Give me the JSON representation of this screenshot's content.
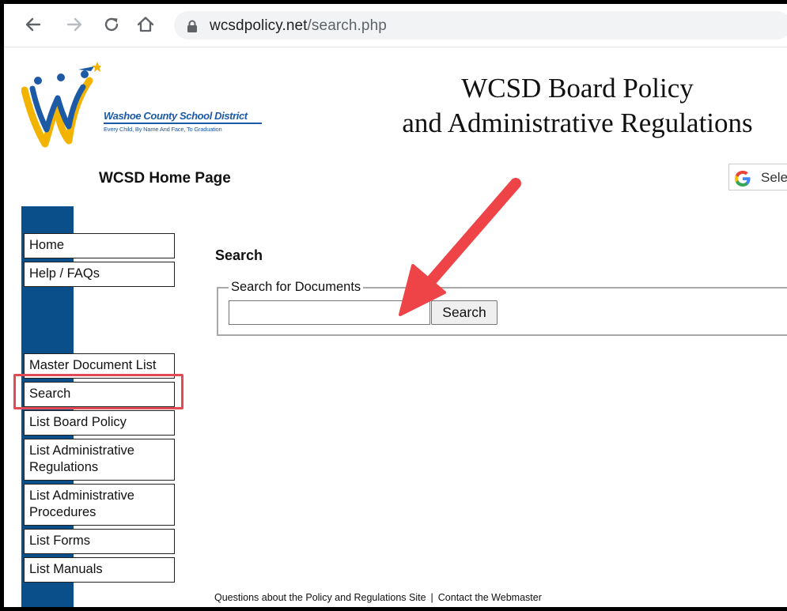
{
  "browser": {
    "url_domain": "wcsdpolicy.net",
    "url_path": "/search.php"
  },
  "header": {
    "logo_name": "Washoe County School District",
    "logo_tagline": "Every Child, By Name And Face, To Graduation",
    "title_line1": "WCSD Board Policy",
    "title_line2": "and Administrative Regulations",
    "home_link": "WCSD Home Page",
    "translate_label": "Sele"
  },
  "sidebar": {
    "items": [
      {
        "label": "Home"
      },
      {
        "label": "Help / FAQs"
      },
      {
        "label": "Master Document List"
      },
      {
        "label": "Search"
      },
      {
        "label": "List Board Policy"
      },
      {
        "label": "List Administrative Regulations"
      },
      {
        "label": "List Administrative Procedures"
      },
      {
        "label": "List Forms"
      },
      {
        "label": "List Manuals"
      }
    ]
  },
  "main": {
    "heading": "Search",
    "legend": "Search for Documents",
    "search_value": "",
    "search_button": "Search"
  },
  "footer": {
    "link1": "Questions about the Policy and Regulations Site",
    "separator": "|",
    "link2": "Contact the Webmaster"
  },
  "colors": {
    "sidebar": "#0b4f8a",
    "highlight": "#e24a55",
    "arrow": "#ee4448",
    "logo_blue": "#1c5aa6",
    "logo_gold": "#f2b400"
  },
  "icons": [
    "back-arrow-icon",
    "forward-arrow-icon",
    "reload-icon",
    "home-icon",
    "lock-icon",
    "google-g-icon",
    "annotation-arrow-icon"
  ]
}
